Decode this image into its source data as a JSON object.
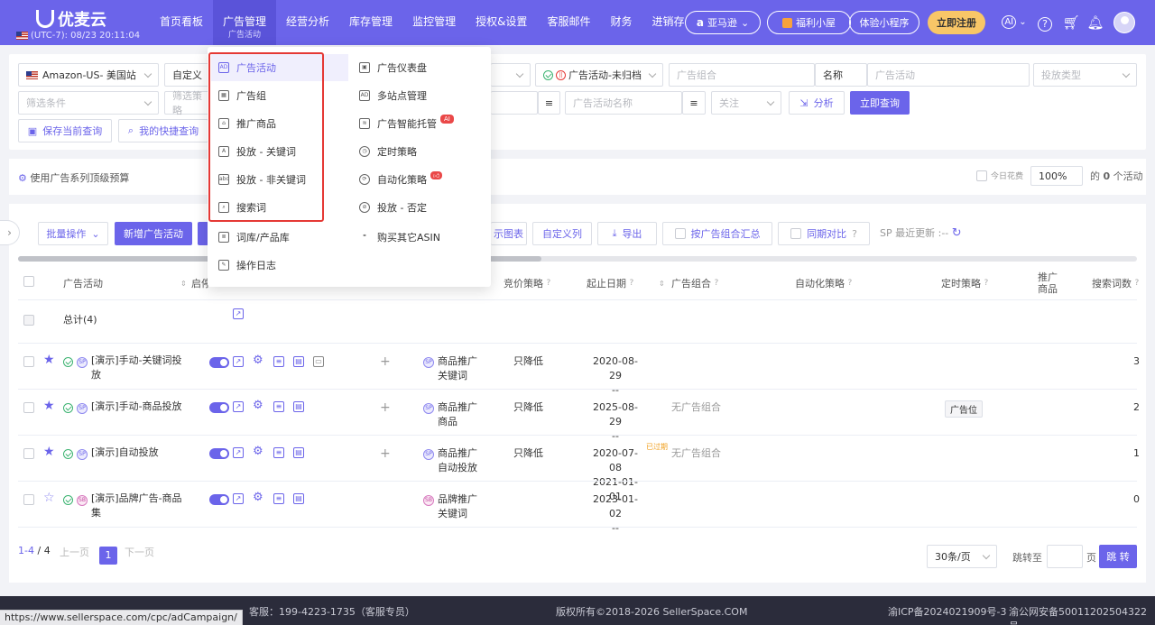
{
  "brand": {
    "name": "优麦云",
    "timezone": "(UTC-7): 08/23 20:11:04"
  },
  "nav": {
    "items": [
      "首页看板",
      "广告管理",
      "经营分析",
      "库存管理",
      "监控管理",
      "授权&设置",
      "客服邮件",
      "财务",
      "进销存"
    ],
    "active_sub": "广告活动"
  },
  "header": {
    "amazon": "亚马逊",
    "welfare": "福利小屋",
    "mini_program": "体验小程序",
    "register": "立即注册",
    "ai": "AI"
  },
  "filters": {
    "marketplace": "Amazon-US- 美国站",
    "custom": "自定义",
    "condition_placeholder": "筛选条件",
    "strategy_placeholder": "筛选策略",
    "campaign_status": "广告活动-未归档",
    "portfolio_placeholder": "广告组合",
    "name_label": "名称",
    "campaign_placeholder": "广告活动",
    "ad_type_placeholder": "投放类型",
    "campaign_name_placeholder": "广告活动名称",
    "follow_placeholder": "关注",
    "analyze": "分析",
    "query": "立即查询",
    "save_query": "保存当前查询",
    "my_queries": "我的快捷查询"
  },
  "budget": {
    "label": "使用广告系列顶级预算",
    "today_spend": "今日花费",
    "percent": "100%",
    "count_text_prefix": "的",
    "count": "0",
    "count_text_suffix": "个活动"
  },
  "toolbar": {
    "batch": "批量操作",
    "new_campaign": "新增广告活动",
    "chart": "示图表",
    "custom_columns": "自定义列",
    "export": "导出",
    "group_summary": "按广告组合汇总",
    "period_compare": "同期对比",
    "sp_update": "SP 最近更新 :--"
  },
  "table": {
    "headers": {
      "campaign": "广告活动",
      "start": "启停",
      "bid_strategy": "竞价策略",
      "start_date": "起止日期",
      "portfolio": "广告组合",
      "auto_strategy": "自动化策略",
      "timing_strategy": "定时策略",
      "promoted": "推广商品",
      "search_terms": "搜索词数"
    },
    "total": "总计(4)",
    "rows": [
      {
        "name": "[演示]手动-关键词投放",
        "type_line1": "商品推广",
        "type_line2": "关键词",
        "bid": "只降低",
        "date1": "2020-08-29",
        "date2": "--",
        "portfolio": "",
        "timing": "",
        "count": "3",
        "starred": true
      },
      {
        "name": "[演示]手动-商品投放",
        "type_line1": "商品推广",
        "type_line2": "商品",
        "bid": "只降低",
        "date1": "2025-08-29",
        "date2": "--",
        "portfolio": "无广告组合",
        "timing": "广告位",
        "count": "2",
        "starred": true
      },
      {
        "name": "[演示]自动投放",
        "type_line1": "商品推广",
        "type_line2": "自动投放",
        "bid": "只降低",
        "date1": "2020-07-08",
        "date2": "2021-01-01",
        "portfolio": "无广告组合",
        "timing": "",
        "count": "1",
        "starred": true,
        "expired": "已过期"
      },
      {
        "name": "[演示]品牌广告-商品集",
        "type_line1": "品牌推广",
        "type_line2": "关键词",
        "bid": "",
        "date1": "2023-01-02",
        "date2": "--",
        "portfolio": "",
        "timing": "",
        "count": "0",
        "starred": false
      }
    ]
  },
  "pager": {
    "range": "1-4",
    "sep": "/",
    "total": "4",
    "prev": "上一页",
    "page": "1",
    "next": "下一页",
    "page_size": "30条/页",
    "jump_to": "跳转至",
    "page_unit": "页",
    "jump": "跳 转"
  },
  "footer": {
    "service": "客服：199-4223-1735（客服专员）",
    "copyright": "版权所有©2018-2026 SellerSpace.COM",
    "icp": "渝ICP备2024021909号-3",
    "police": "渝公网安备50011202504322号",
    "status_url": "https://www.sellerspace.com/cpc/adCampaign/"
  },
  "dropdown": {
    "left": [
      "广告活动",
      "广告组",
      "推广商品",
      "投放 - 关键词",
      "投放 - 非关键词",
      "搜索词",
      "词库/产品库",
      "操作日志"
    ],
    "right": [
      "广告仪表盘",
      "多站点管理",
      "广告智能托管",
      "定时策略",
      "自动化策略",
      "投放 - 否定",
      "购买其它ASIN"
    ],
    "ai_badge": "AI"
  },
  "colors": {
    "primary": "#6b64ea",
    "highlight": "#e53935",
    "success": "#3cb371",
    "footer": "#2b2c3b"
  }
}
